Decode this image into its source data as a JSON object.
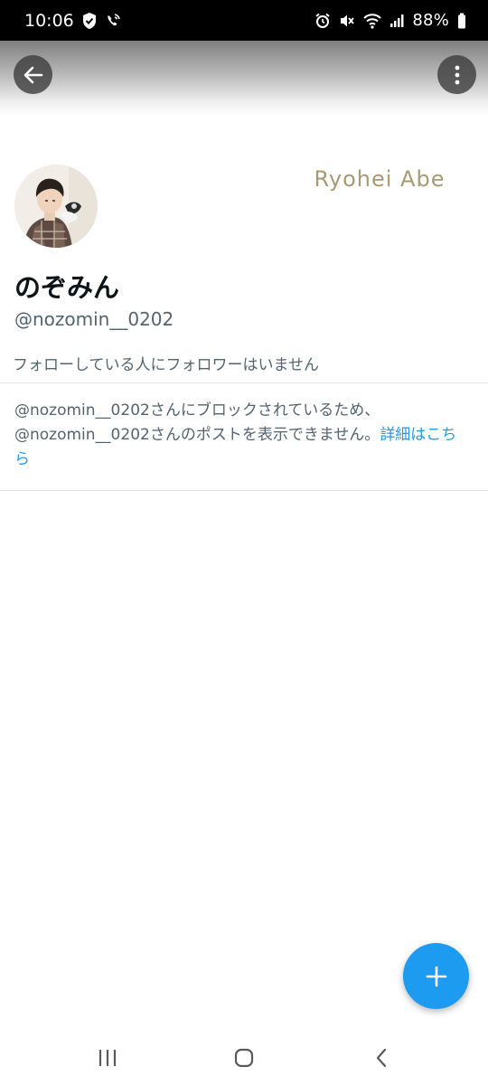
{
  "status_bar": {
    "time": "10:06",
    "battery": "88%",
    "left_icons": [
      "shield-check-icon",
      "wifi-call-icon"
    ],
    "right_icons": [
      "alarm-icon",
      "mute-icon",
      "wifi-icon",
      "signal-icon",
      "battery-icon"
    ]
  },
  "header": {
    "back_icon": "arrow-left-icon",
    "more_icon": "more-vertical-icon"
  },
  "profile": {
    "watermark": "Ryohei Abe",
    "display_name": "のぞみん",
    "handle": "@nozomin__0202",
    "followers_note": "フォローしている人にフォロワーはいません"
  },
  "blocked_notice": {
    "line1": "@nozomin__0202さんにブロックされているため、",
    "line2": "@nozomin__0202さんのポストを表示できません。",
    "link": "詳細はこちら"
  },
  "fab": {
    "icon": "plus-icon"
  },
  "nav_bar": {
    "icons": [
      "recents-icon",
      "home-icon",
      "back-icon"
    ]
  },
  "colors": {
    "accent": "#1d9bf0",
    "secondary_text": "#536471",
    "primary_text": "#0f1419",
    "divider": "#e1e6ea",
    "watermark": "#a89a73"
  }
}
